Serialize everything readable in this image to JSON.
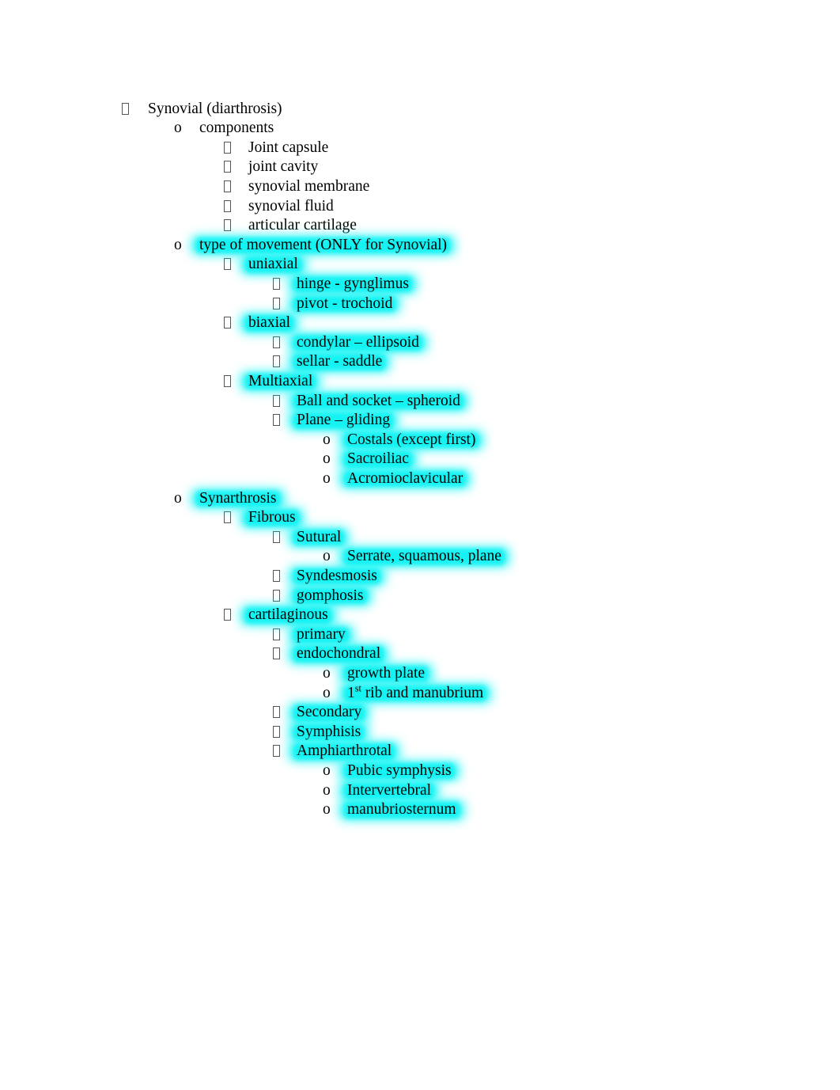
{
  "document": {
    "page_background": "#ffffff",
    "text_color": "#000000",
    "highlight_color": "#00f5f5",
    "bullet_glyphs": {
      "tofu": "missing-glyph-box",
      "circle": "o"
    },
    "outline": [
      {
        "level": 1,
        "bullet": "tofu",
        "text": "Synovial (diarthrosis)",
        "highlight": false
      },
      {
        "level": 2,
        "bullet": "circle",
        "text": "components",
        "highlight": false
      },
      {
        "level": 3,
        "bullet": "tofu",
        "text": "Joint capsule",
        "highlight": false
      },
      {
        "level": 3,
        "bullet": "tofu",
        "text": "joint cavity",
        "highlight": false
      },
      {
        "level": 3,
        "bullet": "tofu",
        "text": "synovial membrane",
        "highlight": false
      },
      {
        "level": 3,
        "bullet": "tofu",
        "text": "synovial fluid",
        "highlight": false
      },
      {
        "level": 3,
        "bullet": "tofu",
        "text": "articular cartilage",
        "highlight": false
      },
      {
        "level": 2,
        "bullet": "circle",
        "text": "type of movement (ONLY for Synovial)",
        "highlight": true
      },
      {
        "level": 3,
        "bullet": "tofu",
        "text": "uniaxial",
        "highlight": true
      },
      {
        "level": 4,
        "bullet": "tofu",
        "text": "hinge - gynglimus",
        "highlight": true
      },
      {
        "level": 4,
        "bullet": "tofu",
        "text": "pivot - trochoid",
        "highlight": true
      },
      {
        "level": 3,
        "bullet": "tofu",
        "text": "biaxial",
        "highlight": true
      },
      {
        "level": 4,
        "bullet": "tofu",
        "text": "condylar – ellipsoid",
        "highlight": true
      },
      {
        "level": 4,
        "bullet": "tofu",
        "text": "sellar - saddle",
        "highlight": true
      },
      {
        "level": 3,
        "bullet": "tofu",
        "text": "Multiaxial",
        "highlight": true
      },
      {
        "level": 4,
        "bullet": "tofu",
        "text": "Ball and socket – spheroid",
        "highlight": true
      },
      {
        "level": 4,
        "bullet": "tofu",
        "text": "Plane – gliding",
        "highlight": true
      },
      {
        "level": 5,
        "bullet": "circle",
        "text": "Costals (except first)",
        "highlight": true
      },
      {
        "level": 5,
        "bullet": "circle",
        "text": "Sacroiliac",
        "highlight": true
      },
      {
        "level": 5,
        "bullet": "circle",
        "text": "Acromioclavicular",
        "highlight": true
      },
      {
        "level": 2,
        "bullet": "circle",
        "text": "Synarthrosis",
        "highlight": true
      },
      {
        "level": 3,
        "bullet": "tofu",
        "text": "Fibrous",
        "highlight": true
      },
      {
        "level": 4,
        "bullet": "tofu",
        "text": "Sutural",
        "highlight": true
      },
      {
        "level": 5,
        "bullet": "circle",
        "text": "Serrate, squamous, plane",
        "highlight": true
      },
      {
        "level": 4,
        "bullet": "tofu",
        "text": "Syndesmosis",
        "highlight": true
      },
      {
        "level": 4,
        "bullet": "tofu",
        "text": "gomphosis",
        "highlight": true
      },
      {
        "level": 3,
        "bullet": "tofu",
        "text": "cartilaginous",
        "highlight": true
      },
      {
        "level": 4,
        "bullet": "tofu",
        "text": "primary",
        "highlight": true
      },
      {
        "level": 4,
        "bullet": "tofu",
        "text": "endochondral",
        "highlight": true
      },
      {
        "level": 5,
        "bullet": "circle",
        "text": "growth plate",
        "highlight": true
      },
      {
        "level": 5,
        "bullet": "circle",
        "text": "1st rib and manubrium",
        "highlight": true,
        "superscript": {
          "base": "1",
          "sup": "st",
          "rest": " rib and manubrium"
        }
      },
      {
        "level": 4,
        "bullet": "tofu",
        "text": "Secondary",
        "highlight": true
      },
      {
        "level": 4,
        "bullet": "tofu",
        "text": "Symphisis",
        "highlight": true
      },
      {
        "level": 4,
        "bullet": "tofu",
        "text": "Amphiarthrotal",
        "highlight": true
      },
      {
        "level": 5,
        "bullet": "circle",
        "text": "Pubic symphysis",
        "highlight": true
      },
      {
        "level": 5,
        "bullet": "circle",
        "text": "Intervertebral",
        "highlight": true
      },
      {
        "level": 5,
        "bullet": "circle",
        "text": "manubriosternum",
        "highlight": true
      }
    ]
  }
}
